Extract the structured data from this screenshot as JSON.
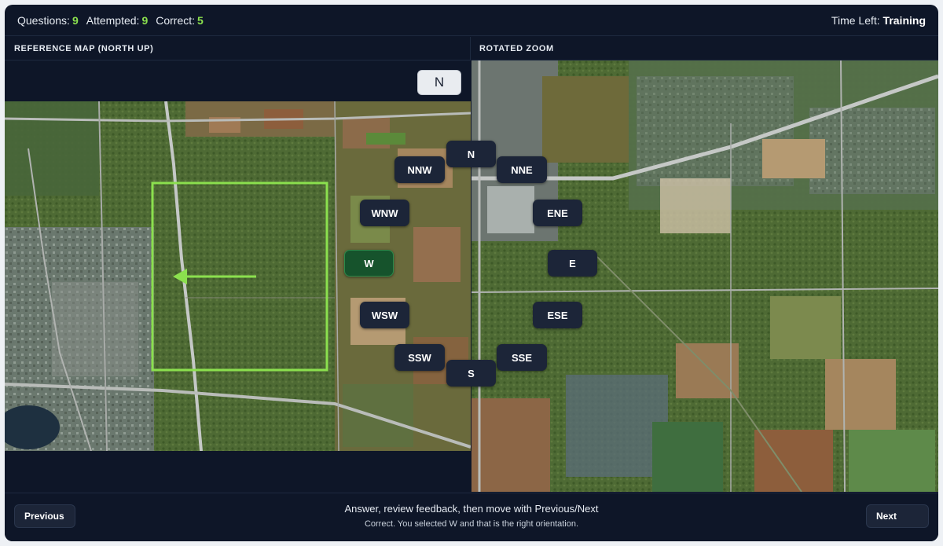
{
  "stats": {
    "questions_label": "Questions:",
    "questions": "9",
    "attempted_label": "Attempted:",
    "attempted": "9",
    "correct_label": "Correct:",
    "correct": "5"
  },
  "time": {
    "label": "Time Left:",
    "value": "Training"
  },
  "panels": {
    "left_title": "REFERENCE MAP (NORTH UP)",
    "right_title": "ROTATED ZOOM"
  },
  "north_button": "N",
  "compass": {
    "selected": "W",
    "directions": [
      "N",
      "NNE",
      "ENE",
      "E",
      "ESE",
      "SSE",
      "S",
      "SSW",
      "WSW",
      "W",
      "WNW",
      "NNW"
    ]
  },
  "footer": {
    "previous": "Previous",
    "next": "Next",
    "instruction": "Answer, review feedback, then move with Previous/Next",
    "feedback": "Correct. You selected W and that is the right orientation."
  },
  "colors": {
    "accent": "#8be04e",
    "selected_button": "#16532c",
    "background": "#0e1628"
  }
}
